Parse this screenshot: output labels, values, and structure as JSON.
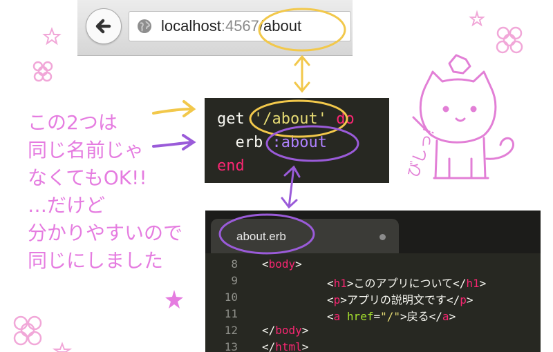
{
  "browser": {
    "url_host": "localhost",
    "url_port": ":4567",
    "url_path": "/about"
  },
  "route_code": {
    "lines": [
      [
        "get",
        "'/about'",
        "do"
      ],
      [
        "erb",
        ":about"
      ],
      [
        "end"
      ]
    ]
  },
  "editor": {
    "tab_label": "about.erb",
    "lines": [
      {
        "num": "8",
        "open": "<",
        "tag": "body",
        "close": ">"
      },
      {
        "num": "9",
        "tag": "h1",
        "text": "このアプリについて"
      },
      {
        "num": "10",
        "tag": "p",
        "text": "アプリの説明文です"
      },
      {
        "num": "11",
        "tag": "a",
        "attr": "href",
        "eq": "=",
        "value": "\"/\"",
        "text": "戻る"
      },
      {
        "num": "12",
        "tag": "body"
      },
      {
        "num": "13",
        "tag": "html"
      }
    ]
  },
  "annotation": {
    "lines": [
      "この2つは",
      "同じ名前じゃ",
      "なくてもOK!!",
      "…だけど",
      "分かりやすいので",
      "同じにしました"
    ],
    "cat_caption": "びしっ!"
  },
  "colors": {
    "yellow": "#f2c84b",
    "purple": "#9a5bd9",
    "pink": "#e57ce0",
    "editor_bg": "#272822"
  }
}
